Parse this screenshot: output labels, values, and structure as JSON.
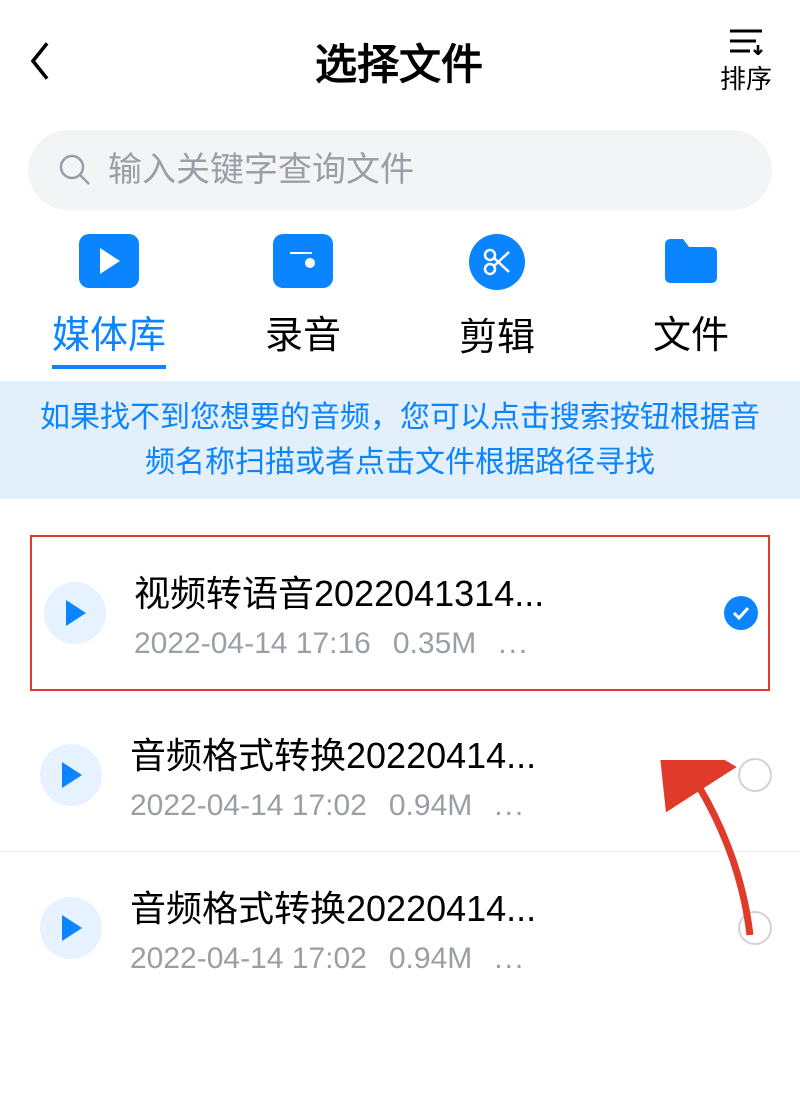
{
  "header": {
    "title": "选择文件",
    "sort_label": "排序"
  },
  "search": {
    "placeholder": "输入关键字查询文件"
  },
  "tabs": [
    {
      "label": "媒体库",
      "active": true
    },
    {
      "label": "录音",
      "active": false
    },
    {
      "label": "剪辑",
      "active": false
    },
    {
      "label": "文件",
      "active": false
    }
  ],
  "banner": {
    "text": "如果找不到您想要的音频，您可以点击搜索按钮根据音频名称扫描或者点击文件根据路径寻找"
  },
  "files": [
    {
      "title": "视频转语音2022041314...",
      "date": "2022-04-14 17:16",
      "size": "0.35M",
      "more": "...",
      "selected": true,
      "highlight": true
    },
    {
      "title": "音频格式转换20220414...",
      "date": "2022-04-14 17:02",
      "size": "0.94M",
      "more": "...",
      "selected": false,
      "highlight": false
    },
    {
      "title": "音频格式转换20220414...",
      "date": "2022-04-14 17:02",
      "size": "0.94M",
      "more": "...",
      "selected": false,
      "highlight": false
    }
  ]
}
